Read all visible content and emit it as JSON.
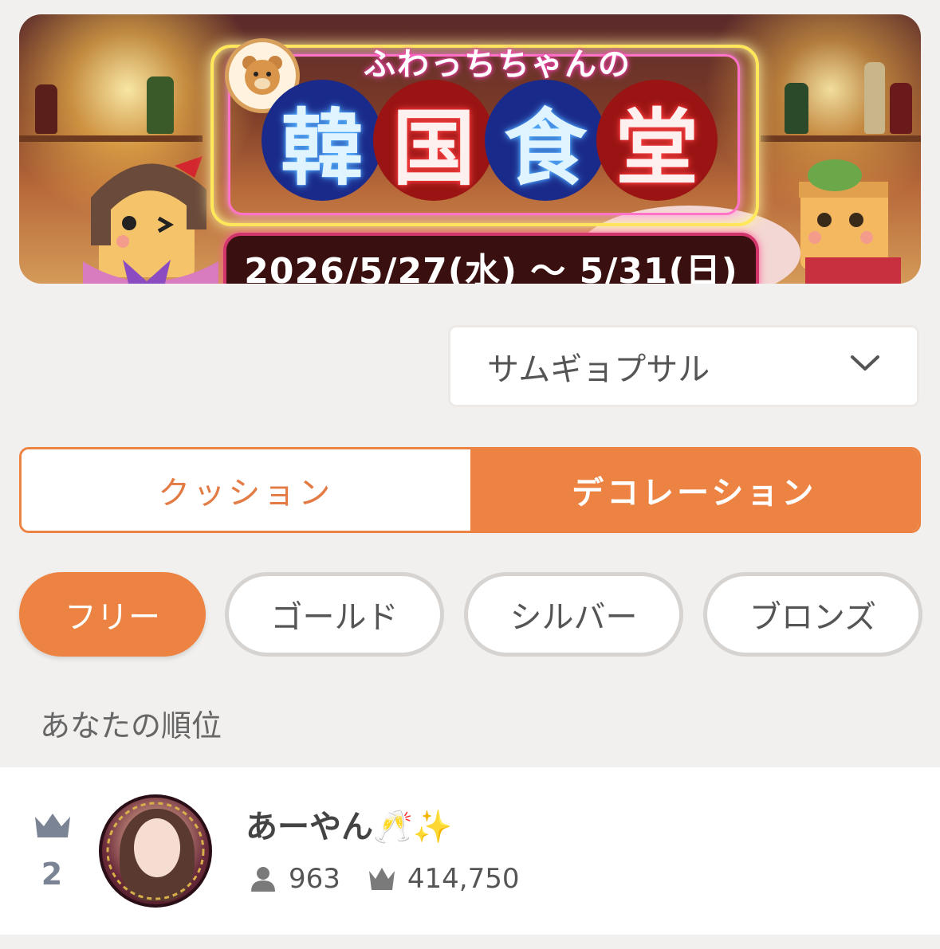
{
  "banner": {
    "subtitle": "ふわっちちゃんの",
    "title_chars": [
      "韓",
      "国",
      "食",
      "堂"
    ],
    "date_range": "2026/5/27(水) 〜 5/31(日)"
  },
  "menu_select": {
    "value": "サムギョプサル",
    "icon": "chevron-down-icon"
  },
  "segment": {
    "options": [
      {
        "label": "クッション",
        "active": false
      },
      {
        "label": "デコレーション",
        "active": true
      }
    ]
  },
  "tiers": [
    {
      "label": "フリー",
      "active": true
    },
    {
      "label": "ゴールド",
      "active": false
    },
    {
      "label": "シルバー",
      "active": false
    },
    {
      "label": "ブロンズ",
      "active": false
    }
  ],
  "your_rank": {
    "section_label": "あなたの順位",
    "rank": "2",
    "name": "あーやん🥂✨",
    "followers": "963",
    "points": "414,750"
  },
  "colors": {
    "accent": "#ed8342",
    "background": "#f2f0ee",
    "pill_border": "#d6d3d1",
    "rank_icon": "#7a8494"
  }
}
